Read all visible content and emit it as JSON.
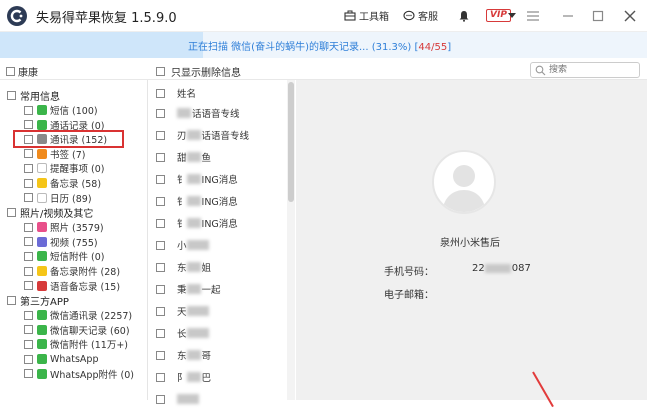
{
  "app": {
    "title": "失易得苹果恢复  1.5.9.0"
  },
  "toolbar": {
    "toolbox_label": "工具箱",
    "service_label": "客服",
    "vip_label": "VIP"
  },
  "progress": {
    "status_text": "正在扫描 微信(奋斗的蜗牛)的聊天记录... (31.3%)",
    "count": "44/55",
    "fraction": 0.313
  },
  "left_header": {
    "label": "康康"
  },
  "mid_header": {
    "label": "只显示删除信息"
  },
  "search": {
    "placeholder": "搜索"
  },
  "tree": {
    "common": {
      "label": "常用信息"
    },
    "common_items": [
      {
        "label": "短信 (100)",
        "icon": "message-icon",
        "color": "#3bb54a"
      },
      {
        "label": "通话记录 (0)",
        "icon": "phone-icon",
        "color": "#3bb54a"
      },
      {
        "label": "通讯录 (152)",
        "icon": "contacts-icon",
        "color": "#8a8a8a"
      },
      {
        "label": "书签 (7)",
        "icon": "bookmark-icon",
        "color": "#f08a1c"
      },
      {
        "label": "提醒事项 (0)",
        "icon": "reminder-icon",
        "color": "#ffffff"
      },
      {
        "label": "备忘录 (58)",
        "icon": "notes-icon",
        "color": "#f5c518"
      },
      {
        "label": "日历 (89)",
        "icon": "calendar-icon",
        "color": "#ffffff"
      }
    ],
    "media": {
      "label": "照片/视频及其它"
    },
    "media_items": [
      {
        "label": "照片 (3579)",
        "icon": "photos-icon",
        "color": "#e8508a"
      },
      {
        "label": "视频 (755)",
        "icon": "video-icon",
        "color": "#6b6bd6"
      },
      {
        "label": "短信附件 (0)",
        "icon": "sms-attachment-icon",
        "color": "#3bb54a"
      },
      {
        "label": "备忘录附件 (28)",
        "icon": "notes-attachment-icon",
        "color": "#f5c518"
      },
      {
        "label": "语音备忘录 (15)",
        "icon": "voice-memo-icon",
        "color": "#d73a3a"
      }
    ],
    "thirdparty": {
      "label": "第三方APP"
    },
    "thirdparty_items": [
      {
        "label": "微信通讯录 (2257)",
        "icon": "wechat-icon",
        "color": "#3bb54a"
      },
      {
        "label": "微信聊天记录 (60)",
        "icon": "wechat-icon",
        "color": "#3bb54a"
      },
      {
        "label": "微信附件 (11万+)",
        "icon": "wechat-icon",
        "color": "#3bb54a"
      },
      {
        "label": "WhatsApp",
        "icon": "whatsapp-icon",
        "color": "#3bb54a"
      },
      {
        "label": "WhatsApp附件 (0)",
        "icon": "whatsapp-icon",
        "color": "#3bb54a"
      }
    ]
  },
  "contacts_list": {
    "column_header": "姓名",
    "rows": [
      {
        "prefix": "",
        "visible": "话语音专线"
      },
      {
        "prefix": "刃",
        "visible": "话语音专线"
      },
      {
        "prefix": "甜",
        "visible": "鱼"
      },
      {
        "prefix": "钅",
        "visible": "ING消息"
      },
      {
        "prefix": "钅",
        "visible": "ING消息"
      },
      {
        "prefix": "钅",
        "visible": "ING消息"
      },
      {
        "prefix": "小",
        "visible": ""
      },
      {
        "prefix": "东",
        "visible": "姐"
      },
      {
        "prefix": "秉",
        "visible": "一起"
      },
      {
        "prefix": "天",
        "visible": ""
      },
      {
        "prefix": "长",
        "visible": ""
      },
      {
        "prefix": "东",
        "visible": "哥"
      },
      {
        "prefix": "阝",
        "visible": "巴"
      },
      {
        "prefix": "",
        "visible": ""
      }
    ]
  },
  "detail": {
    "name": "泉州小米售后",
    "phone_label": "手机号码：",
    "phone_value_start": "22",
    "phone_value_end": "087",
    "email_label": "电子邮箱："
  },
  "colors": {
    "accent": "#2f7fd8",
    "highlight": "#d93232",
    "count": "#d63a3a"
  }
}
